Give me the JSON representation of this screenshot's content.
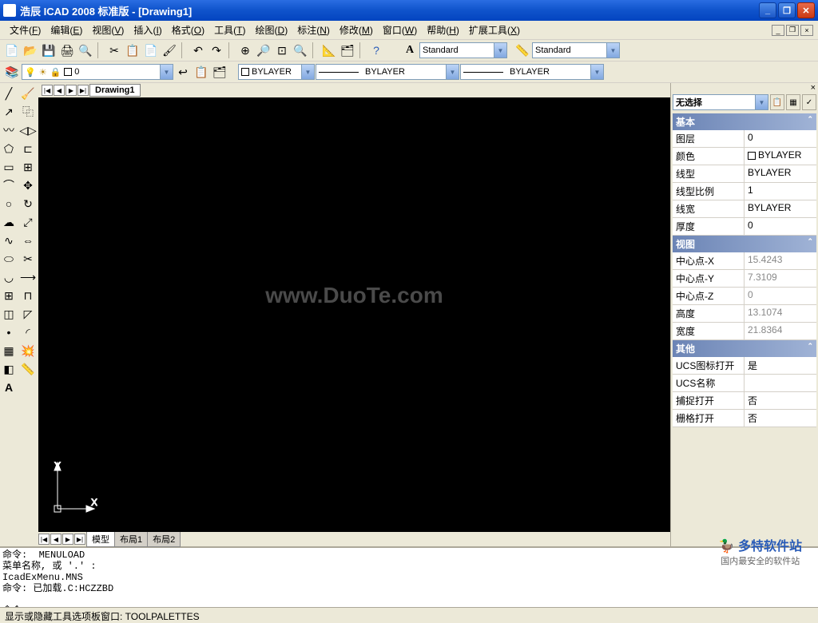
{
  "title": "浩辰 ICAD 2008 标准版 - [Drawing1]",
  "menus": [
    {
      "label": "文件",
      "key": "F"
    },
    {
      "label": "编辑",
      "key": "E"
    },
    {
      "label": "视图",
      "key": "V"
    },
    {
      "label": "插入",
      "key": "I"
    },
    {
      "label": "格式",
      "key": "O"
    },
    {
      "label": "工具",
      "key": "T"
    },
    {
      "label": "绘图",
      "key": "D"
    },
    {
      "label": "标注",
      "key": "N"
    },
    {
      "label": "修改",
      "key": "M"
    },
    {
      "label": "窗口",
      "key": "W"
    },
    {
      "label": "帮助",
      "key": "H"
    },
    {
      "label": "扩展工具",
      "key": "X"
    }
  ],
  "toolbar1_combos": {
    "dim_style": "Standard",
    "text_style": "Standard"
  },
  "layer_row": {
    "layer": "0",
    "color_label": "BYLAYER",
    "linetype": "BYLAYER",
    "lineweight": "BYLAYER"
  },
  "file_tab": "Drawing1",
  "watermark": "www.DuoTe.com",
  "model_tabs": [
    "模型",
    "布局1",
    "布局2"
  ],
  "props": {
    "selection": "无选择",
    "sections": [
      {
        "title": "基本",
        "rows": [
          {
            "k": "图层",
            "v": "0"
          },
          {
            "k": "颜色",
            "v": "BYLAYER",
            "swatch": "#fff"
          },
          {
            "k": "线型",
            "v": "BYLAYER"
          },
          {
            "k": "线型比例",
            "v": "1"
          },
          {
            "k": "线宽",
            "v": "BYLAYER"
          },
          {
            "k": "厚度",
            "v": "0"
          }
        ]
      },
      {
        "title": "视图",
        "rows": [
          {
            "k": "中心点-X",
            "v": "15.4243",
            "gray": true
          },
          {
            "k": "中心点-Y",
            "v": "7.3109",
            "gray": true
          },
          {
            "k": "中心点-Z",
            "v": "0",
            "gray": true
          },
          {
            "k": "高度",
            "v": "13.1074",
            "gray": true
          },
          {
            "k": "宽度",
            "v": "21.8364",
            "gray": true
          }
        ]
      },
      {
        "title": "其他",
        "rows": [
          {
            "k": "UCS图标打开",
            "v": "是"
          },
          {
            "k": "UCS名称",
            "v": ""
          },
          {
            "k": "捕捉打开",
            "v": "否"
          },
          {
            "k": "栅格打开",
            "v": "否"
          }
        ]
      }
    ]
  },
  "cmd_lines": [
    "命令:  MENULOAD",
    "菜单名称, 或 '.' :",
    "IcadExMenu.MNS",
    "命令: 已加载.C:HCZZBD"
  ],
  "cmd_prompt": "命令: ",
  "statusbar": "显示或隐藏工具选项板窗口:  TOOLPALETTES",
  "duote": {
    "brand": "多特软件站",
    "sub": "国内最安全的软件站"
  }
}
